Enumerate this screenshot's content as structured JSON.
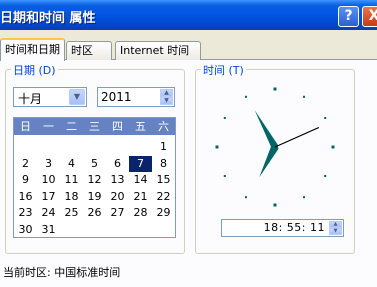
{
  "window": {
    "title": "日期和时间 属性",
    "help_label": "?",
    "close_label": "X"
  },
  "tabs": [
    {
      "label": "时间和日期"
    },
    {
      "label": "时区"
    },
    {
      "label": "Internet 时间"
    }
  ],
  "date_group": {
    "label": "日期 (D)",
    "month_value": "十月",
    "year_value": "2011",
    "weekdays": [
      "日",
      "一",
      "二",
      "三",
      "四",
      "五",
      "六"
    ],
    "days": [
      [
        "",
        "",
        "",
        "",
        "",
        "",
        "1"
      ],
      [
        "2",
        "3",
        "4",
        "5",
        "6",
        "7",
        "8"
      ],
      [
        "9",
        "10",
        "11",
        "12",
        "13",
        "14",
        "15"
      ],
      [
        "16",
        "17",
        "18",
        "19",
        "20",
        "21",
        "22"
      ],
      [
        "23",
        "24",
        "25",
        "26",
        "27",
        "28",
        "29"
      ],
      [
        "30",
        "31",
        "",
        "",
        "",
        "",
        ""
      ]
    ],
    "selected_day": "7"
  },
  "time_group": {
    "label": "时间 (T)",
    "time_value": "18: 55: 11",
    "clock": {
      "hour": 18,
      "minute": 55,
      "second": 11
    }
  },
  "status": {
    "current_timezone": "当前时区:  中国标准时间"
  },
  "colors": {
    "titlebar": "#0054e3",
    "calendar_header": "#6682c3",
    "selected_day": "#0a246a",
    "hands": "#006666",
    "group_label": "#0046d5"
  }
}
